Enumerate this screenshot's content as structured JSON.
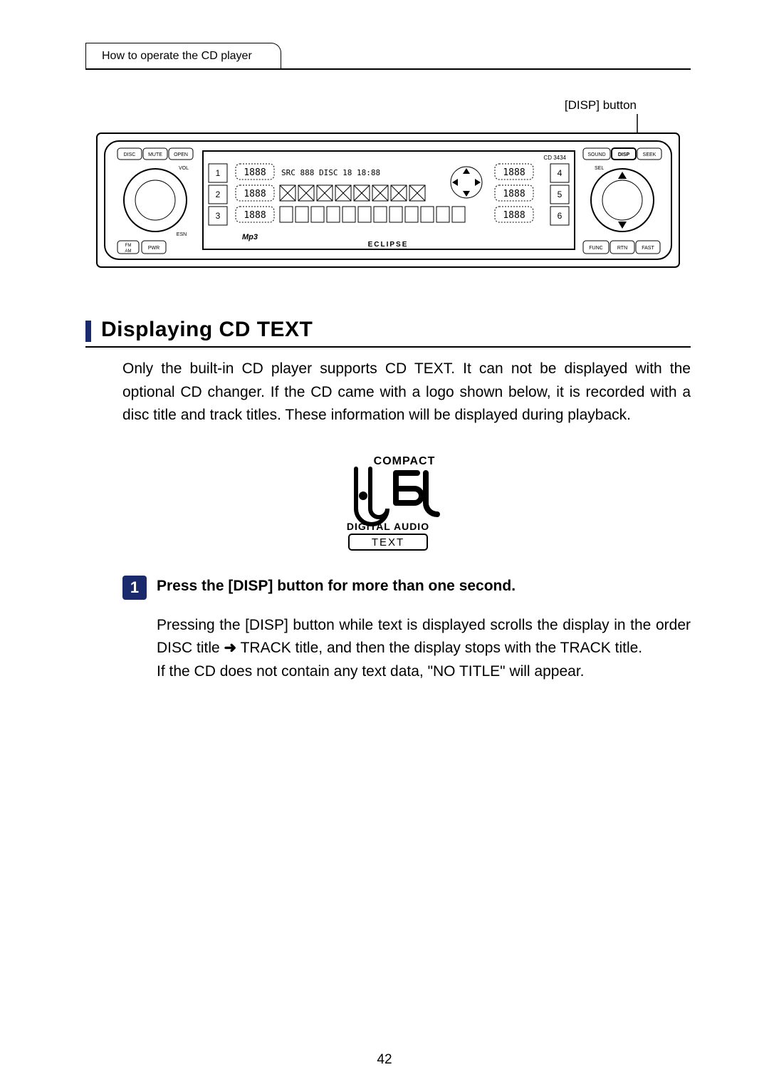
{
  "header": {
    "section_label": "How to operate the CD player"
  },
  "diagram": {
    "callout": "[DISP] button",
    "model": "CD 3434",
    "brand": "ECLIPSE",
    "left_buttons": {
      "disc": "DISC",
      "mute": "MUTE",
      "open": "OPEN",
      "vol": "VOL",
      "esn": "ESN",
      "fm": "FM",
      "am": "AM",
      "pwr": "PWR"
    },
    "right_buttons": {
      "sound": "SOUND",
      "disp": "DISP",
      "seek": "SEEK",
      "sel": "SEL",
      "func": "FUNC",
      "rtn": "RTN",
      "fast": "FAST"
    },
    "preset_left": [
      "1",
      "2",
      "3"
    ],
    "preset_right": [
      "4",
      "5",
      "6"
    ],
    "mp3_label": "Mp3",
    "display_top": "SRC 888 DISC 18 18:88",
    "display_digits": "1888"
  },
  "section": {
    "title": "Displaying CD TEXT"
  },
  "intro": "Only the built-in CD player supports CD TEXT. It can not be displayed with the optional CD changer. If the CD came with a logo shown below, it is recorded with a disc title and track titles. These information will be displayed during playback.",
  "cd_logo": {
    "top": "COMPACT",
    "mid_icon": "disc",
    "bottom1": "DIGITAL AUDIO",
    "bottom2": "TEXT"
  },
  "step": {
    "num": "1",
    "title": "Press the [DISP] button for more than one second.",
    "body_a": "Pressing the [DISP] button while text is displayed scrolls the display in the order DISC title ",
    "arrow": "➜",
    "body_b": " TRACK title, and then the display stops with the TRACK title.",
    "body_c": "If the CD does not contain any text data, \"NO TITLE\" will appear."
  },
  "page_number": "42"
}
